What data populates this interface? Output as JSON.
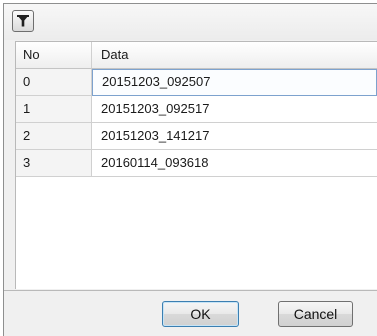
{
  "toolbar": {
    "filter_icon": "filter-icon"
  },
  "grid": {
    "columns": [
      "No",
      "Data"
    ],
    "rows": [
      {
        "no": "0",
        "data": "20151203_092507"
      },
      {
        "no": "1",
        "data": "20151203_092517"
      },
      {
        "no": "2",
        "data": "20151203_141217"
      },
      {
        "no": "3",
        "data": "20160114_093618"
      }
    ]
  },
  "buttons": {
    "ok": "OK",
    "cancel": "Cancel"
  },
  "colors": {
    "selection_border": "#7da2ce",
    "ok_border": "#3c7fb1"
  }
}
